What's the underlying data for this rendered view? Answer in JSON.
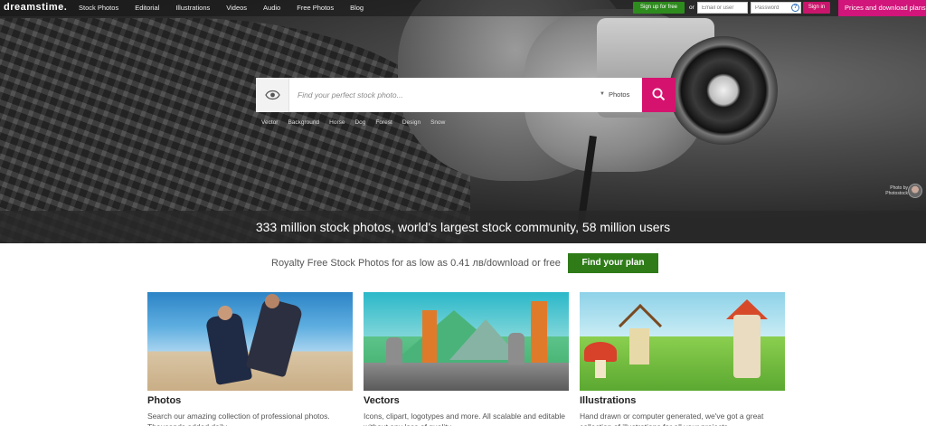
{
  "header": {
    "logo": "dreamstime.",
    "nav": [
      "Stock Photos",
      "Editorial",
      "Illustrations",
      "Videos",
      "Audio",
      "Free Photos",
      "Blog"
    ],
    "signup_label": "Sign up for free",
    "or_label": "or",
    "email_placeholder": "Email or user",
    "password_placeholder": "Password",
    "help_icon_glyph": "?",
    "signin_label": "Sign in",
    "prices_label": "Prices and download plans"
  },
  "hero": {
    "search_placeholder": "Find your perfect stock photo...",
    "search_type": "Photos",
    "tags": [
      "Vector",
      "Background",
      "Horse",
      "Dog",
      "Forest",
      "Design",
      "Snow"
    ],
    "photo_credit": "Photo by Photostock",
    "banner": "333 million stock photos, world's largest stock community, 58 million users"
  },
  "promo": {
    "text": "Royalty Free Stock Photos for as low as 0.41 лв/download or free",
    "button": "Find your plan"
  },
  "cards": [
    {
      "title": "Photos",
      "desc": "Search our amazing collection of professional photos. Thousands added daily."
    },
    {
      "title": "Vectors",
      "desc": "Icons, clipart, logotypes and more. All scalable and editable without any loss of quality."
    },
    {
      "title": "Illustrations",
      "desc": "Hand drawn or computer generated, we've got a great collection of illustrations for all your projects."
    }
  ],
  "colors": {
    "accent_pink": "#d6126f",
    "signup_green": "#2e8b1e",
    "plan_green": "#2e7b18"
  },
  "icons": {
    "preview": "eye-icon",
    "search": "magnifier-icon",
    "dropdown": "chevron-down-icon",
    "help": "help-icon"
  }
}
